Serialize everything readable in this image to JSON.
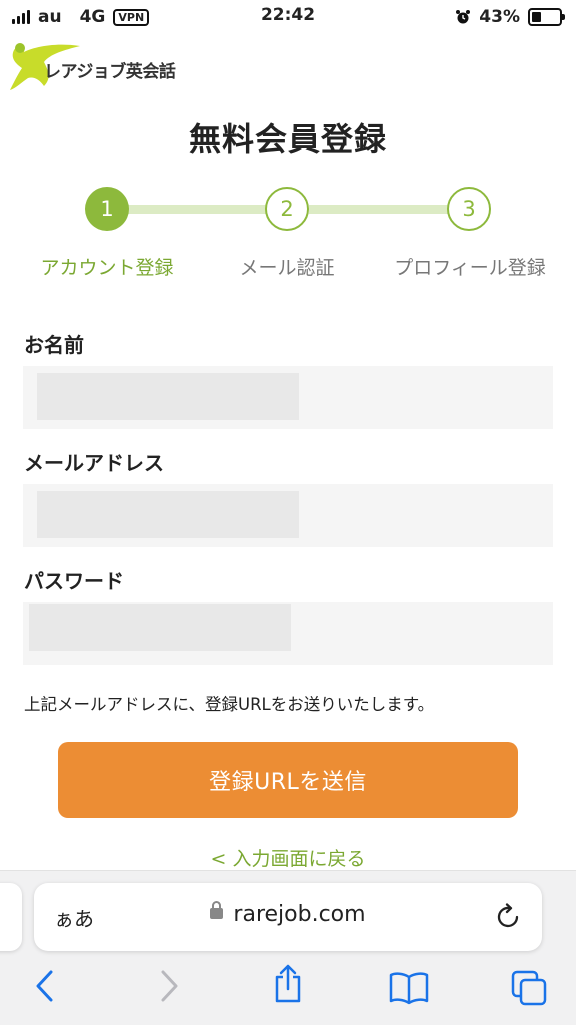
{
  "status_bar": {
    "carrier": "au",
    "network": "4G",
    "vpn": "VPN",
    "time": "22:42",
    "battery": "43%",
    "battery_level": 0.43
  },
  "logo": {
    "text": "レアジョブ英会話"
  },
  "page_title": "無料会員登録",
  "steps": [
    {
      "number": "1",
      "label": "アカウント登録",
      "state": "active"
    },
    {
      "number": "2",
      "label": "メール認証",
      "state": "todo"
    },
    {
      "number": "3",
      "label": "プロフィール登録",
      "state": "todo"
    }
  ],
  "form": {
    "name_label": "お名前",
    "email_label": "メールアドレス",
    "password_label": "パスワード",
    "note": "上記メールアドレスに、登録URLをお送りいたします。",
    "submit_label": "登録URLを送信",
    "back_link": "< 入力画面に戻る"
  },
  "browser": {
    "text_size_label": "ぁあ",
    "url": "rarejob.com"
  },
  "colors": {
    "accent_green": "#8db93c",
    "button_orange": "#ec8d34",
    "ios_blue": "#1a73e8"
  }
}
